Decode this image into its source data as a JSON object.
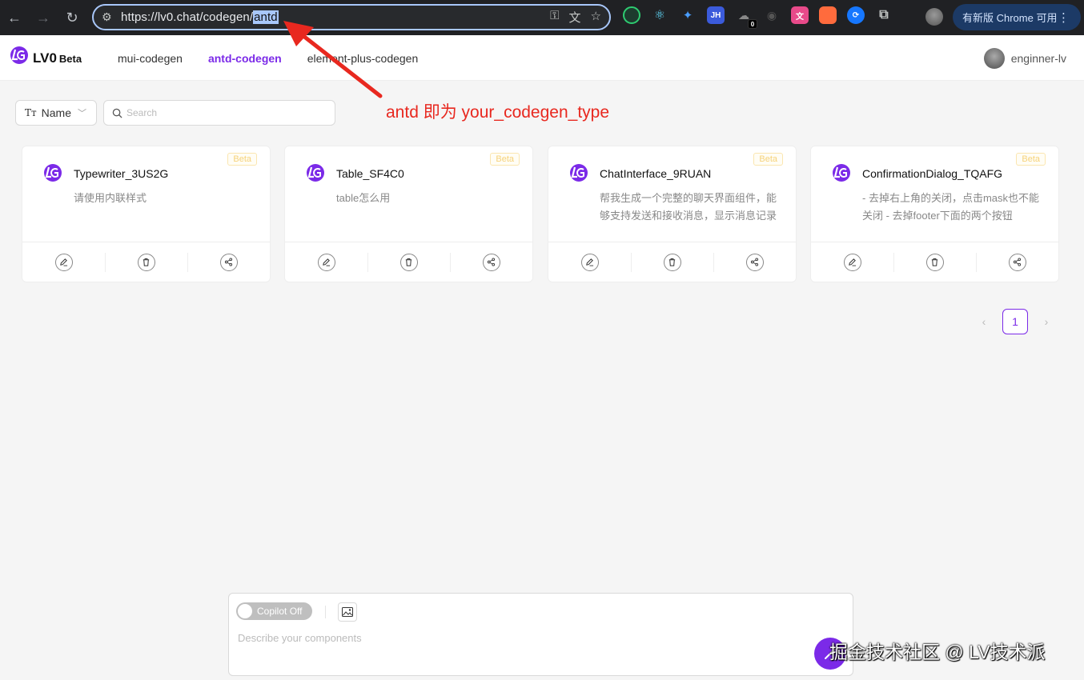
{
  "browser": {
    "url_prefix": "https://lv0.chat/codegen/",
    "url_selected": "antd",
    "extension_badge": "0",
    "extension_jh_label": "JH",
    "update_button": "有新版 Chrome 可用"
  },
  "header": {
    "brand": "LV0",
    "brand_tag": "Beta",
    "nav": [
      {
        "label": "mui-codegen"
      },
      {
        "label": "antd-codegen"
      },
      {
        "label": "element-plus-codegen"
      }
    ],
    "username": "enginner-lv"
  },
  "filters": {
    "field_label": "Name",
    "field_icon_text": "Tт",
    "search_placeholder": "Search"
  },
  "annotation": {
    "text": "antd 即为 your_codegen_type",
    "color": "#e8281f"
  },
  "cards": [
    {
      "title": "Typewriter_3US2G",
      "desc": "请使用内联样式",
      "badge": "Beta"
    },
    {
      "title": "Table_SF4C0",
      "desc": "table怎么用",
      "badge": "Beta"
    },
    {
      "title": "ChatInterface_9RUAN",
      "desc": "帮我生成一个完整的聊天界面组件，能够支持发送和接收消息，显示消息记录",
      "badge": "Beta"
    },
    {
      "title": "ConfirmationDialog_TQAFG",
      "desc": "- 去掉右上角的关闭，点击mask也不能关闭 - 去掉footer下面的两个按钮",
      "badge": "Beta"
    }
  ],
  "pagination": {
    "current": "1"
  },
  "prompt": {
    "copilot_label": "Copilot Off",
    "placeholder": "Describe your components"
  },
  "watermark": "掘金技术社区 @ LV技术派",
  "colors": {
    "accent": "#7b2ae8",
    "beta_badge": "#f6d27a"
  }
}
